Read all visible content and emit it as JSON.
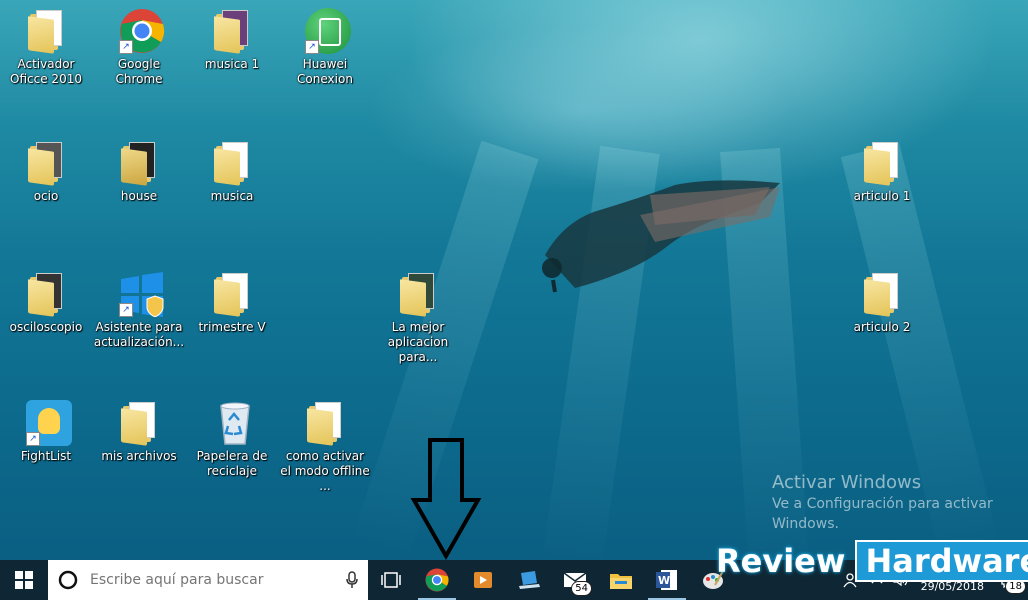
{
  "desktop_icons": [
    {
      "label": "Activador Oficce 2010",
      "icon": "folder-icon"
    },
    {
      "label": "Google Chrome",
      "icon": "chrome-icon"
    },
    {
      "label": "musica 1",
      "icon": "folder-icon"
    },
    {
      "label": "Huawei Conexion",
      "icon": "huawei-icon"
    },
    {
      "label": "ocio",
      "icon": "folder-icon"
    },
    {
      "label": "house",
      "icon": "folder-icon"
    },
    {
      "label": "musica",
      "icon": "folder-icon"
    },
    {
      "label": "articulo 1",
      "icon": "folder-icon"
    },
    {
      "label": "osciloscopio",
      "icon": "folder-icon"
    },
    {
      "label": "Asistente para actualización...",
      "icon": "windows-update-icon"
    },
    {
      "label": "trimestre V",
      "icon": "folder-icon"
    },
    {
      "label": "La mejor aplicacion para...",
      "icon": "folder-icon"
    },
    {
      "label": "articulo 2",
      "icon": "folder-icon"
    },
    {
      "label": "FightList",
      "icon": "fightlist-icon"
    },
    {
      "label": "mis archivos",
      "icon": "folder-icon"
    },
    {
      "label": "Papelera de reciclaje",
      "icon": "recycle-bin-icon"
    },
    {
      "label": "como activar el modo offline ...",
      "icon": "folder-icon"
    }
  ],
  "watermark": {
    "title": "Activar Windows",
    "subtitle": "Ve a Configuración para activar Windows."
  },
  "taskbar": {
    "search_placeholder": "Escribe aquí para buscar",
    "apps": [
      {
        "name": "task-view-icon"
      },
      {
        "name": "chrome-icon"
      },
      {
        "name": "media-player-icon"
      },
      {
        "name": "laptop-icon"
      },
      {
        "name": "mail-icon",
        "badge": "54"
      },
      {
        "name": "file-explorer-icon"
      },
      {
        "name": "word-icon"
      },
      {
        "name": "paint-icon"
      }
    ],
    "date": "29/05/2018",
    "notification_count": "18"
  },
  "brand": {
    "review": "Review",
    "hardware": "Hardware"
  },
  "colors": {
    "taskbar": "#0f2734",
    "accent": "#1e9ad6"
  }
}
